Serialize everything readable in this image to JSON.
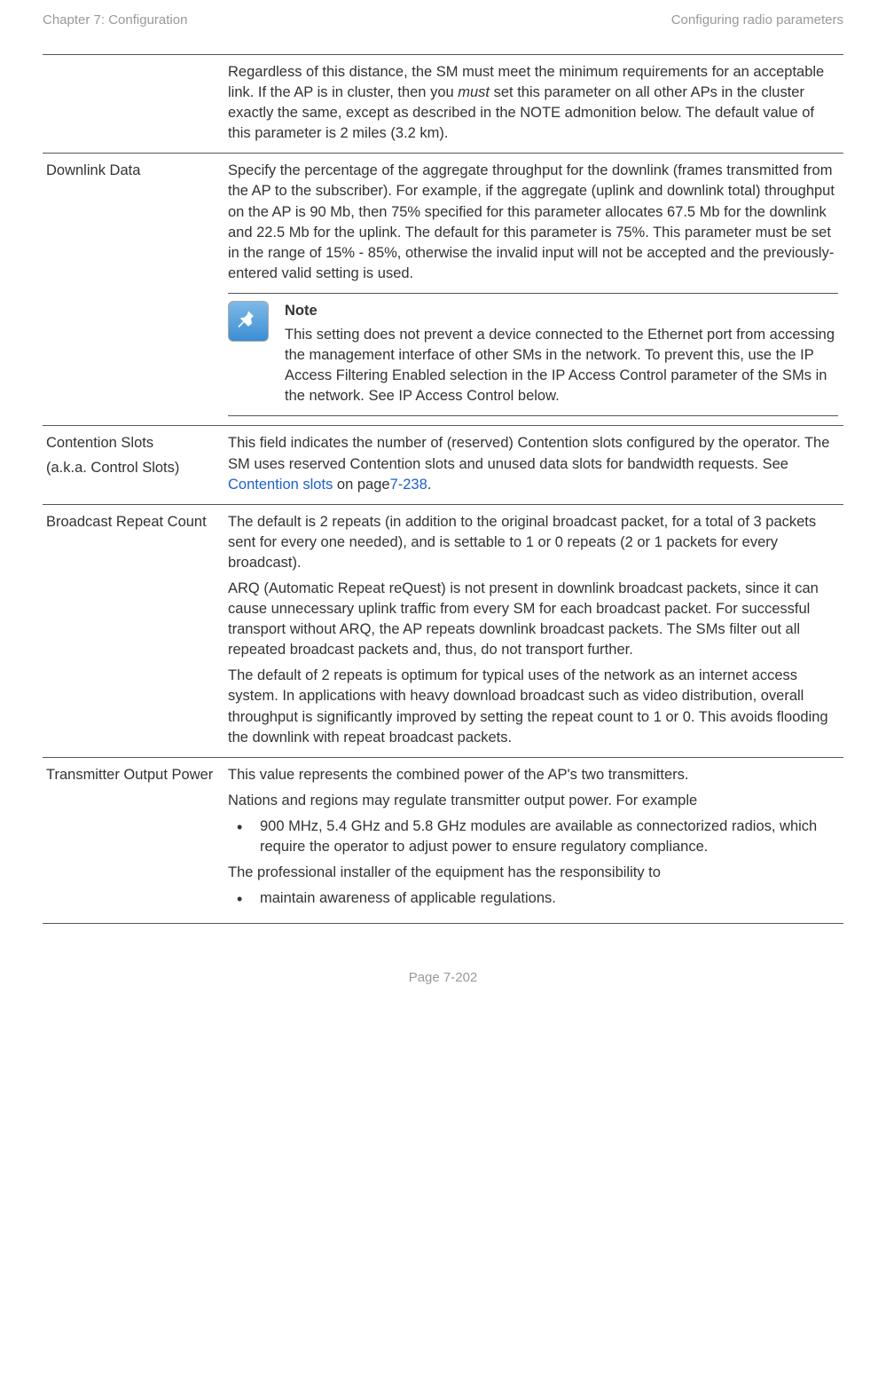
{
  "header": {
    "left": "Chapter 7:  Configuration",
    "right": "Configuring radio parameters"
  },
  "rows": {
    "r0": {
      "attr": "",
      "body": {
        "p1a": "Regardless of this distance, the SM must meet the minimum requirements for an acceptable link. If the AP is in cluster, then you ",
        "p1em": "must",
        "p1b": " set this parameter on all other APs in the cluster exactly the same, except as described in the NOTE admonition below. The default value of this parameter is 2 miles (3.2 km)."
      }
    },
    "r1": {
      "attr": "Downlink Data",
      "body": {
        "p1": "Specify the percentage of the aggregate throughput for the downlink (frames transmitted from the AP to the subscriber). For example, if the aggregate (uplink and downlink total) throughput on the AP is 90 Mb, then 75% specified for this parameter allocates 67.5 Mb for the downlink and 22.5 Mb for the uplink. The default for this parameter is 75%. This parameter must be set in the range of 15% - 85%, otherwise the invalid input will not be accepted and the previously-entered valid setting is used.",
        "noteTitle": "Note",
        "noteBody": "This setting does not prevent a device connected to the Ethernet port from accessing the management interface of other SMs in the network. To prevent this, use the IP Access Filtering Enabled selection in the IP Access Control parameter of the SMs in the network. See IP Access Control below."
      }
    },
    "r2": {
      "attr": "Contention Slots",
      "attrSub": "(a.k.a. Control Slots)",
      "body": {
        "p1a": "This field indicates the number of (reserved) Contention slots configured by the operator. The SM uses reserved Contention slots and unused data slots for bandwidth requests. See ",
        "link": "Contention slots",
        "p1b": " on page",
        "pageref": "7-238",
        "p1c": "."
      }
    },
    "r3": {
      "attr": "Broadcast Repeat Count",
      "body": {
        "p1": "The default is 2 repeats (in addition to the original broadcast packet, for a total of 3 packets sent for every one needed), and is settable to 1 or 0 repeats (2 or 1 packets for every broadcast).",
        "p2": "ARQ (Automatic Repeat reQuest) is not present in downlink broadcast packets, since it can cause unnecessary uplink traffic from every SM for each broadcast packet. For successful transport without ARQ, the AP repeats downlink broadcast packets. The SMs filter out all repeated broadcast packets and, thus, do not transport further.",
        "p3": "The default of 2 repeats is optimum for typical uses of the network as an internet access system. In applications with heavy download broadcast such as video distribution, overall throughput is significantly improved by setting the repeat count to 1 or 0. This avoids flooding the downlink with repeat broadcast packets."
      }
    },
    "r4": {
      "attr": "Transmitter Output Power",
      "body": {
        "p1": "This value represents the combined power of the AP's two transmitters.",
        "p2": "Nations and regions may regulate transmitter output power. For example",
        "bullet1": "900 MHz, 5.4 GHz and 5.8 GHz modules are available as connectorized radios, which require the operator to adjust power to ensure regulatory compliance.",
        "p3": "The professional installer of the equipment has the responsibility to",
        "bullet2": "maintain awareness of applicable regulations."
      }
    }
  },
  "footer": "Page 7-202"
}
